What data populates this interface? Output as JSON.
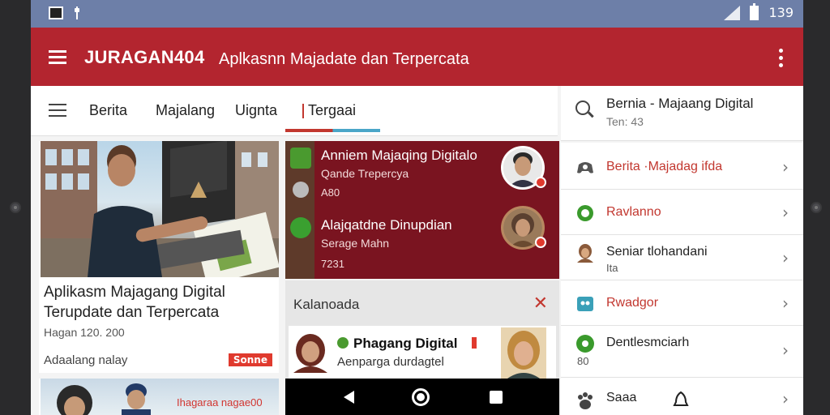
{
  "statusbar": {
    "time": "139"
  },
  "appbar": {
    "brand": "JURAGAN404",
    "subtitle": "Aplkasnn Majadate dan Terpercata"
  },
  "tabs": [
    {
      "label": "Berita"
    },
    {
      "label": "Majalang"
    },
    {
      "label": "Uignta"
    },
    {
      "label": "Tergaai"
    }
  ],
  "right_header": {
    "title": "Bernia - Majaang Digital",
    "subtitle": "Ten: 43"
  },
  "main_card": {
    "title": "Aplikasm Majagang Digital Terupdate dan Terpercata",
    "meta": "Hagan 120.  200",
    "footer": "Adaalang nalay",
    "badge": "Sonne"
  },
  "small_card": {
    "caption": "Ihagaraa nagae00"
  },
  "feed": [
    {
      "title": "Anniem Majaqing Digitalo",
      "subtitle": "Qande Trepercya",
      "meta": "A80"
    },
    {
      "title": "Alajqatdne Dinupdian",
      "subtitle": "Serage Mahn",
      "meta": "7231"
    }
  ],
  "panel": {
    "header": "Kalanoada",
    "card_title": "Phagang Digital",
    "card_subtitle": "Aenparga durdagtel"
  },
  "list": [
    {
      "label": "Berita ·Majadag ifda",
      "sub": "",
      "icon": "game-icon",
      "accent": "#c2372f"
    },
    {
      "label": "Ravlanno",
      "sub": "",
      "icon": "gear-icon",
      "accent": "#c2372f"
    },
    {
      "label": "Seniar tlohandani",
      "sub": "Ita",
      "icon": "user-icon",
      "accent": "#222222"
    },
    {
      "label": "Rwadgor",
      "sub": "",
      "icon": "image-icon",
      "accent": "#c2372f"
    },
    {
      "label": "Dentlesmciarh",
      "sub": "80",
      "icon": "gps-icon",
      "accent": "#222222"
    },
    {
      "label": "Saaa",
      "sub": "",
      "icon": "paw-icon",
      "accent": "#222222"
    }
  ],
  "colors": {
    "primary": "#b3252f",
    "status_bar": "#6d7fa8",
    "feed_bg": "#7a1420",
    "accent_blue": "#4aa6c8"
  }
}
